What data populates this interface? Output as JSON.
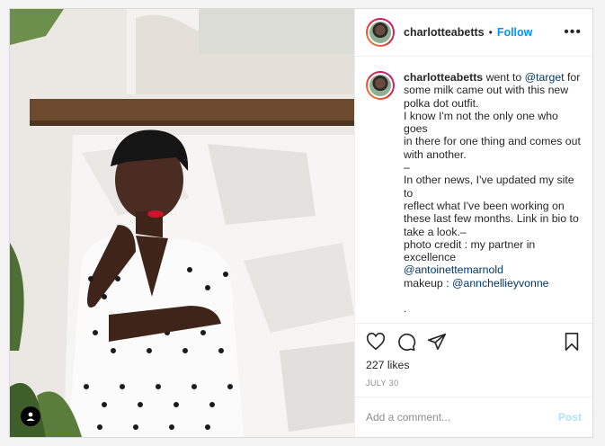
{
  "post": {
    "username": "charlotteabetts",
    "follow_label": "Follow",
    "separator": "•",
    "more": "•••",
    "caption_user": "charlotteabetts",
    "caption_line1": " went to ",
    "caption_mention1": "@target",
    "caption_line2": " for\nsome milk came out with this new\npolka dot outfit.\nI know I'm not the only one who goes\nin there for one thing and comes out\nwith another.\n–\nIn other news, I've updated my site to\nreflect what I've been working on\nthese last few months. Link in bio to\ntake a look.–\nphoto credit : my partner in\nexcellence\n",
    "caption_mention2": "@antoinettemarnold",
    "caption_line3": "\nmakeup : ",
    "caption_mention3": "@annchellieyvonne",
    "caption_line4": "\n\n.\n.\n.\n.",
    "likes": "227 likes",
    "date": "JULY 30",
    "comment_placeholder": "Add a comment...",
    "post_label": "Post"
  },
  "icons": [
    "heart-icon",
    "comment-icon",
    "share-icon",
    "bookmark-icon",
    "user-tag-icon"
  ],
  "colors": {
    "link": "#00376b",
    "follow": "#0095f6",
    "post_disabled": "#b2dffc"
  }
}
